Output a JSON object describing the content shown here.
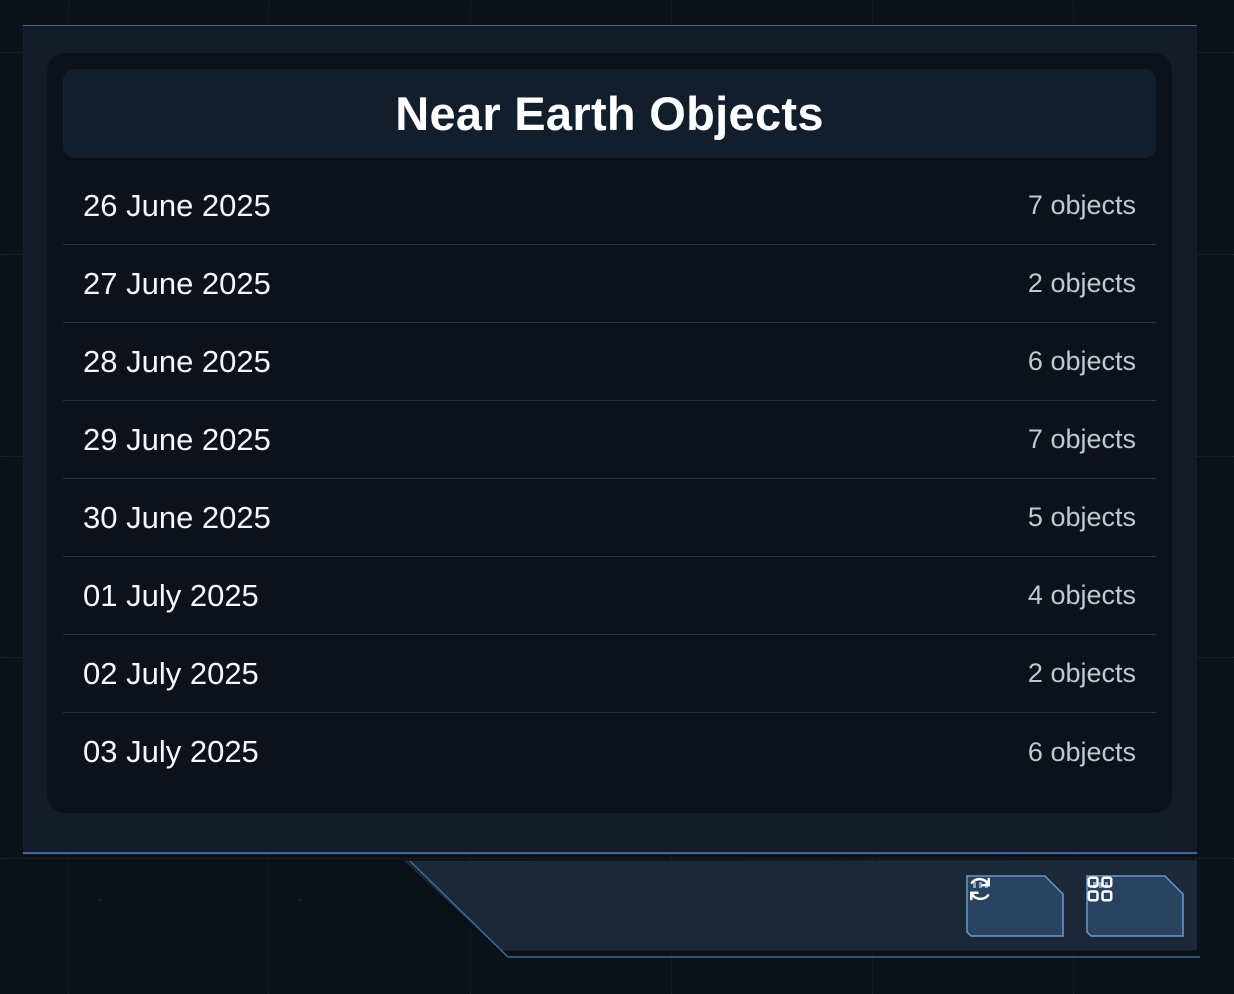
{
  "panel": {
    "title": "Near Earth Objects"
  },
  "entries": [
    {
      "date": "26 June 2025",
      "count": "7 objects"
    },
    {
      "date": "27 June 2025",
      "count": "2 objects"
    },
    {
      "date": "28 June 2025",
      "count": "6 objects"
    },
    {
      "date": "29 June 2025",
      "count": "7 objects"
    },
    {
      "date": "30 June 2025",
      "count": "5 objects"
    },
    {
      "date": "01 July 2025",
      "count": "4 objects"
    },
    {
      "date": "02 July 2025",
      "count": "2 objects"
    },
    {
      "date": "03 July 2025",
      "count": "6 objects"
    }
  ],
  "toolbar": {
    "buttons": [
      {
        "icon": "refresh-icon"
      },
      {
        "icon": "grid-icon"
      }
    ]
  },
  "colors": {
    "background": "#0c1118",
    "frame": "#131c28",
    "card": "#0d1119",
    "accent": "#3f6a98",
    "text": "#f4f6f8",
    "muted_text": "#c2c8d0"
  }
}
